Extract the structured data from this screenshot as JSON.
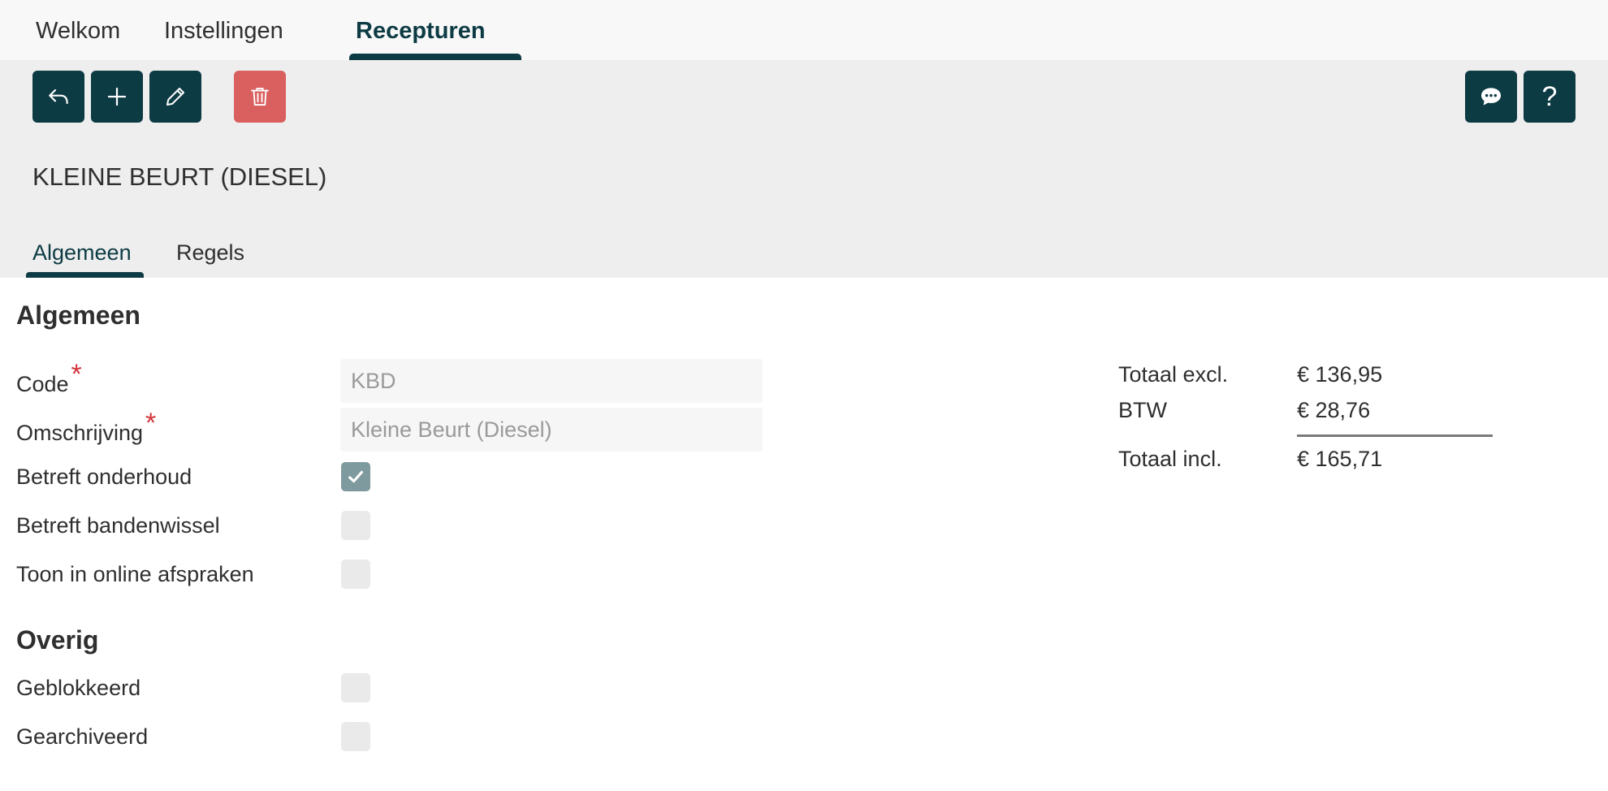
{
  "nav": {
    "tabs": [
      "Welkom",
      "Instellingen",
      "Recepturen"
    ],
    "active_tab": "Recepturen"
  },
  "toolbar": {
    "back_icon": "undo-arrow-icon",
    "add_icon": "plus-icon",
    "edit_icon": "pencil-icon",
    "delete_icon": "trash-icon",
    "chat_icon": "chat-bubble-icon",
    "help_label": "?"
  },
  "record": {
    "title": "KLEINE BEURT (DIESEL)"
  },
  "subtabs": [
    "Algemeen",
    "Regels"
  ],
  "form": {
    "section_general": "Algemeen",
    "code_label": "Code",
    "code_value": "KBD",
    "description_label": "Omschrijving",
    "description_value": "Kleine Beurt (Diesel)",
    "required_mark": "*",
    "maintenance_label": "Betreft onderhoud",
    "maintenance_checked": true,
    "tire_change_label": "Betreft bandenwissel",
    "tire_change_checked": false,
    "online_label": "Toon in online afspraken",
    "online_checked": false,
    "section_other": "Overig",
    "blocked_label": "Geblokkeerd",
    "blocked_checked": false,
    "archived_label": "Gearchiveerd",
    "archived_checked": false
  },
  "totals": {
    "excl_label": "Totaal excl.",
    "excl_value": "€ 136,95",
    "vat_label": "BTW",
    "vat_value": "€ 28,76",
    "incl_label": "Totaal incl.",
    "incl_value": "€ 165,71"
  },
  "colors": {
    "primary": "#0d3b44",
    "danger": "#d9605f",
    "required": "#d4343a",
    "checkbox_checked": "#7f9a9e"
  }
}
